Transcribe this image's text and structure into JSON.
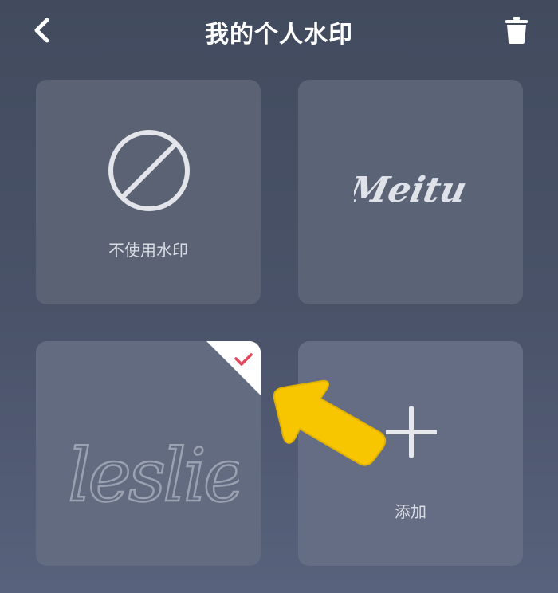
{
  "header": {
    "title": "我的个人水印",
    "back_icon": "chevron-left-icon",
    "delete_icon": "trash-icon"
  },
  "watermarks": {
    "none_label": "不使用水印",
    "meitu_signature": "Meitu",
    "leslie_signature": "leslie",
    "add_label": "添加",
    "selected_index": 2
  },
  "colors": {
    "background_top": "#424b5e",
    "tile": "#5a6274",
    "check_accent": "#e8455c",
    "annotation_arrow": "#f7c600"
  }
}
